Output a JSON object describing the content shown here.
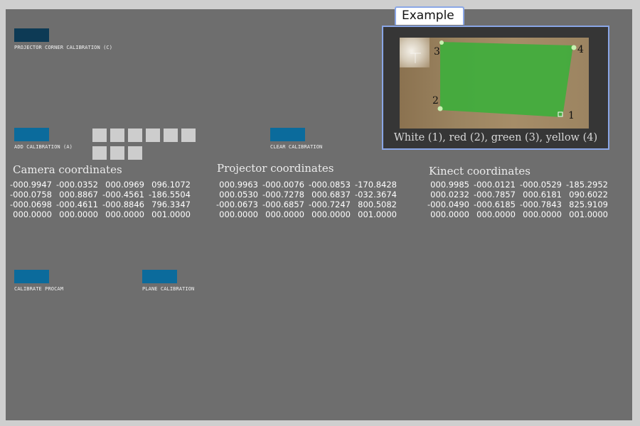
{
  "buttons": {
    "projector_corner": "PROJECTOR CORNER CALIBRATION (C)",
    "add_calibration": "ADD CALIBRATION (A)",
    "clear_calibration": "CLEAR CALIBRATION",
    "calibrate_procam": "CALIBRATE PROCAM",
    "plane_calibration": "PLANE CALIBRATION"
  },
  "calibration_slots": {
    "count": 9
  },
  "example": {
    "tab_label": "Example",
    "caption": "White (1),  red (2), green (3), yellow (4)",
    "markers": [
      "1",
      "2",
      "3",
      "4"
    ]
  },
  "camera": {
    "title": "Camera coordinates",
    "matrix": [
      [
        "-000.9947",
        "-000.0352",
        "000.0969",
        "096.1072"
      ],
      [
        "-000.0758",
        "000.8867",
        "-000.4561",
        "-186.5504"
      ],
      [
        "-000.0698",
        "-000.4611",
        "-000.8846",
        "796.3347"
      ],
      [
        "000.0000",
        "000.0000",
        "000.0000",
        "001.0000"
      ]
    ]
  },
  "projector": {
    "title": "Projector coordinates",
    "matrix": [
      [
        "000.9963",
        "-000.0076",
        "-000.0853",
        "-170.8428"
      ],
      [
        "000.0530",
        "-000.7278",
        "000.6837",
        "-032.3674"
      ],
      [
        "-000.0673",
        "-000.6857",
        "-000.7247",
        "800.5082"
      ],
      [
        "000.0000",
        "000.0000",
        "000.0000",
        "001.0000"
      ]
    ]
  },
  "kinect": {
    "title": "Kinect coordinates",
    "matrix": [
      [
        "000.9985",
        "-000.0121",
        "-000.0529",
        "-185.2952"
      ],
      [
        "000.0232",
        "-000.7857",
        "000.6181",
        "090.6022"
      ],
      [
        "-000.0490",
        "-000.6185",
        "-000.7843",
        "825.9109"
      ],
      [
        "000.0000",
        "000.0000",
        "000.0000",
        "001.0000"
      ]
    ]
  }
}
